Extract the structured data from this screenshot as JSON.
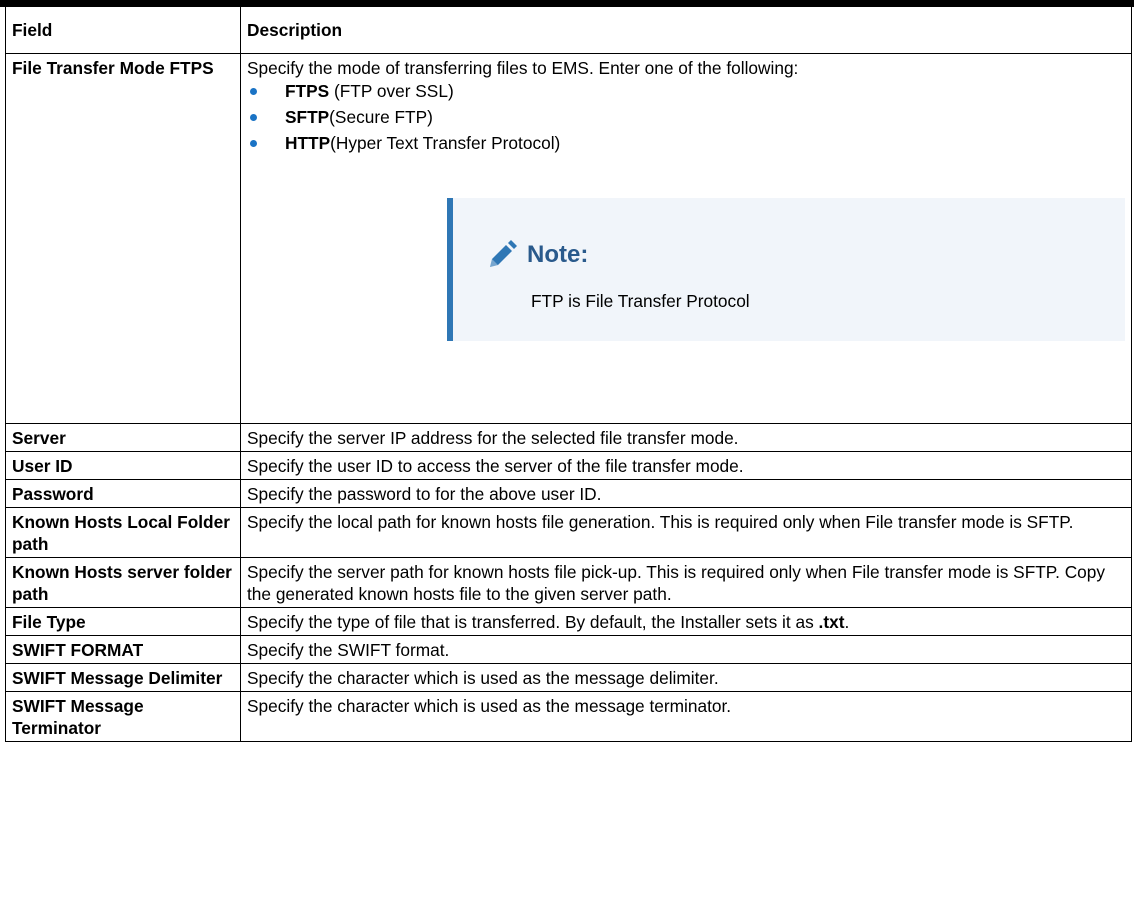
{
  "table": {
    "headers": [
      "Field",
      "Description"
    ],
    "first_row": {
      "field": "File Transfer Mode FTPS",
      "intro": "Specify the mode of transferring files to EMS. Enter one of the following:",
      "options": [
        {
          "term": "FTPS",
          "rest": " (FTP over SSL)"
        },
        {
          "term": "SFTP",
          "rest": "(Secure FTP)"
        },
        {
          "term": "HTTP",
          "rest": "(Hyper Text Transfer Protocol)"
        }
      ],
      "note": {
        "icon": "pencil-icon",
        "title": "Note:",
        "text": "FTP is File Transfer Protocol"
      }
    },
    "rows": [
      {
        "field": "Server",
        "desc": "Specify the server IP address for the selected file transfer mode."
      },
      {
        "field": "User ID",
        "desc": "Specify the user ID to access the server of the file transfer mode."
      },
      {
        "field": "Password",
        "desc": "Specify the password to for the above user ID."
      },
      {
        "field": "Known Hosts Local Folder path",
        "desc": "Specify the local path for known hosts file generation. This is required only when File transfer mode is SFTP."
      },
      {
        "field": "Known Hosts server folder path",
        "desc": "Specify the server path for known hosts file pick-up. This is required only when File transfer mode is SFTP. Copy the generated known hosts file to the given server path."
      },
      {
        "field": "File Type",
        "desc": "Specify the type of file that is transferred. By default, the Installer sets it as ",
        "desc_bold": ".txt",
        "desc_end": "."
      },
      {
        "field": "SWIFT FORMAT",
        "desc": "Specify the SWIFT format."
      },
      {
        "field": "SWIFT Message Delimiter",
        "desc": "Specify the character which is used as the message delimiter."
      },
      {
        "field": "SWIFT Message Terminator",
        "desc": "Specify the character which is used as the message terminator."
      }
    ]
  },
  "colors": {
    "bullet": "#1a73c5",
    "note_bar": "#2f77b5",
    "note_bg": "#f1f5fa",
    "note_title": "#2a5a8c"
  }
}
